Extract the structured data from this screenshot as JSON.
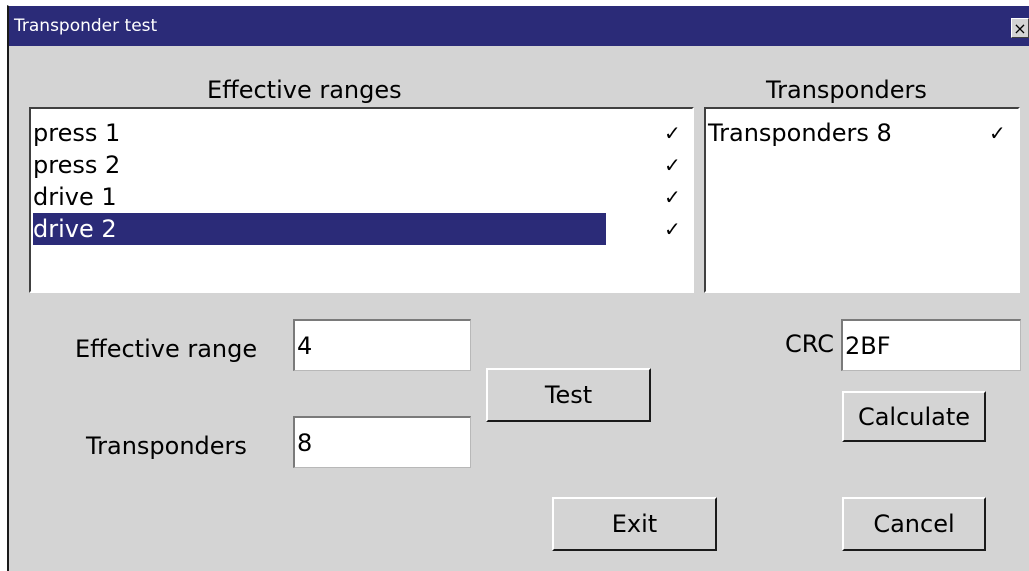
{
  "window": {
    "title": "Transponder test",
    "close_glyph": "×"
  },
  "effective_ranges": {
    "heading": "Effective ranges",
    "items": [
      {
        "label": "press 1",
        "checked": true,
        "check": "✓"
      },
      {
        "label": "press 2",
        "checked": true,
        "check": "✓"
      },
      {
        "label": "drive 1",
        "checked": true,
        "check": "✓"
      },
      {
        "label": "drive 2",
        "checked": true,
        "check": "✓",
        "selected": true
      }
    ]
  },
  "transponders": {
    "heading": "Transponders",
    "items": [
      {
        "label": "Transponders 8",
        "checked": true,
        "check": "✓"
      }
    ]
  },
  "fields": {
    "effective_range_label": "Effective range",
    "effective_range_value": "4",
    "transponders_label": "Transponders",
    "transponders_value": "8",
    "crc_label": "CRC",
    "crc_value": "2BF"
  },
  "buttons": {
    "test": "Test",
    "calculate": "Calculate",
    "exit": "Exit",
    "cancel": "Cancel"
  },
  "colors": {
    "title_bar": "#2b2b78",
    "selection": "#2b2b78",
    "dialog_background": "#d4d4d4"
  }
}
